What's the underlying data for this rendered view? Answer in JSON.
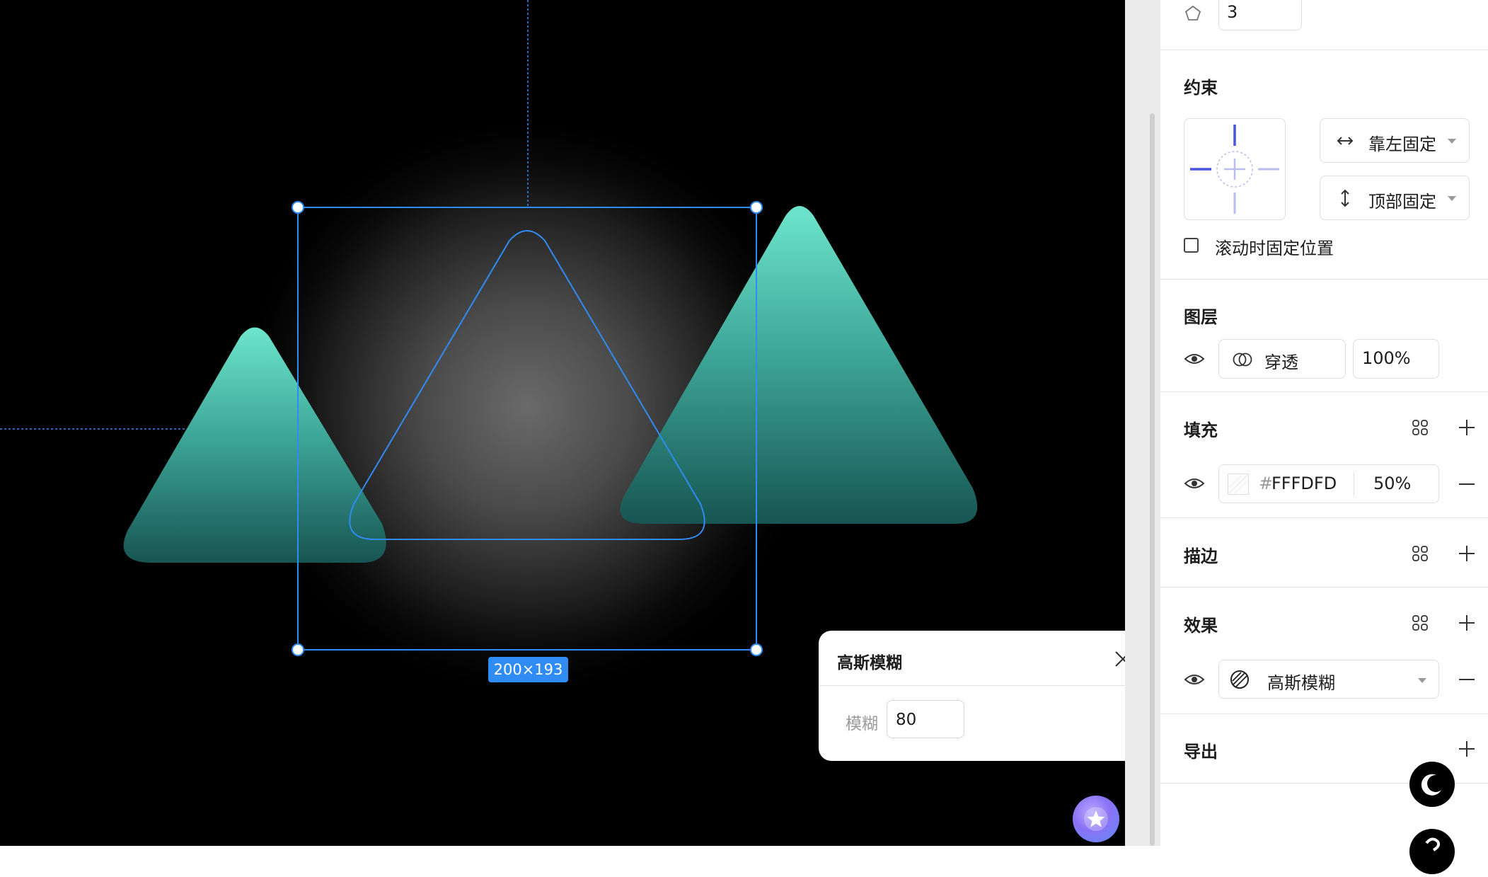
{
  "canvas": {
    "selection_size": "200×193",
    "blur_popup": {
      "title": "高斯模糊",
      "field_label": "模糊",
      "field_value": "80"
    }
  },
  "panel": {
    "sides": {
      "value": "3"
    },
    "constraints": {
      "title": "约束",
      "horizontal": "靠左固定",
      "vertical": "顶部固定",
      "fix_on_scroll": "滚动时固定位置"
    },
    "layer": {
      "title": "图层",
      "blend_mode": "穿透",
      "opacity": "100%"
    },
    "fill": {
      "title": "填充",
      "hash": "#",
      "hex": "FFFDFD",
      "opacity": "50%"
    },
    "stroke": {
      "title": "描边"
    },
    "effect": {
      "title": "效果",
      "type": "高斯模糊"
    },
    "export": {
      "title": "导出"
    }
  },
  "colors": {
    "accent": "#2f8cf5",
    "constraint_blue": "#4a56e0",
    "teal_top": "#6ee6cc",
    "teal_bottom": "#175552"
  }
}
